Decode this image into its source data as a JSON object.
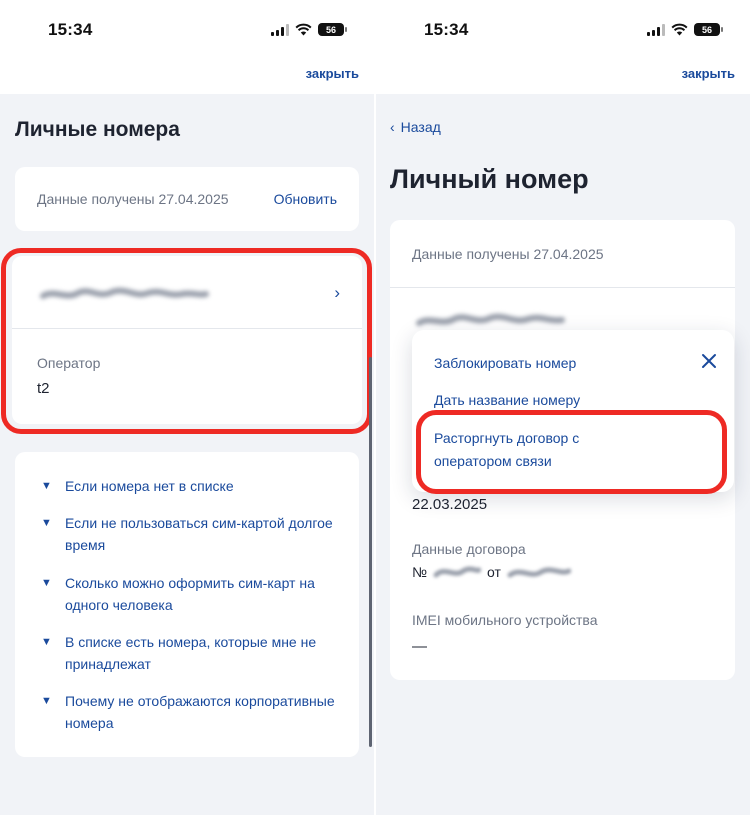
{
  "left": {
    "status": {
      "time": "15:34",
      "battery": "56"
    },
    "nav": {
      "close": "закрыть"
    },
    "title": "Личные номера",
    "data_card": {
      "received": "Данные получены 27.04.2025",
      "refresh": "Обновить"
    },
    "number_card": {
      "operator_label": "Оператор",
      "operator_value": "t2"
    },
    "faq": [
      "Если номера нет в списке",
      "Если не пользоваться сим-картой долгое время",
      "Сколько можно оформить сим-карт на одного человека",
      "В списке есть номера, которые мне не принадлежат",
      "Почему не отображаются корпоративные номера"
    ]
  },
  "right": {
    "status": {
      "time": "15:34",
      "battery": "56"
    },
    "nav": {
      "close": "закрыть"
    },
    "back": "Назад",
    "title": "Личный номер",
    "info": {
      "received": "Данные получены 27.04.2025",
      "registration_date": "22.03.2025",
      "contract_label": "Данные договора",
      "contract_no": "№",
      "contract_from": "от",
      "imei_label": "IMEI мобильного устройства",
      "imei_value": "—"
    },
    "menu": {
      "block": "Заблокировать номер",
      "rename": "Дать название номеру",
      "terminate_line1": "Расторгнуть договор с",
      "terminate_line2": "оператором связи"
    }
  },
  "colors": {
    "accent": "#1a4a9c",
    "highlight": "#ee2a24",
    "background": "#f1f3f7"
  },
  "icons": [
    "wifi-icon",
    "signal-icon",
    "battery-icon",
    "chevron-right-icon",
    "chevron-down-icon",
    "chevron-left-icon",
    "close-icon"
  ]
}
